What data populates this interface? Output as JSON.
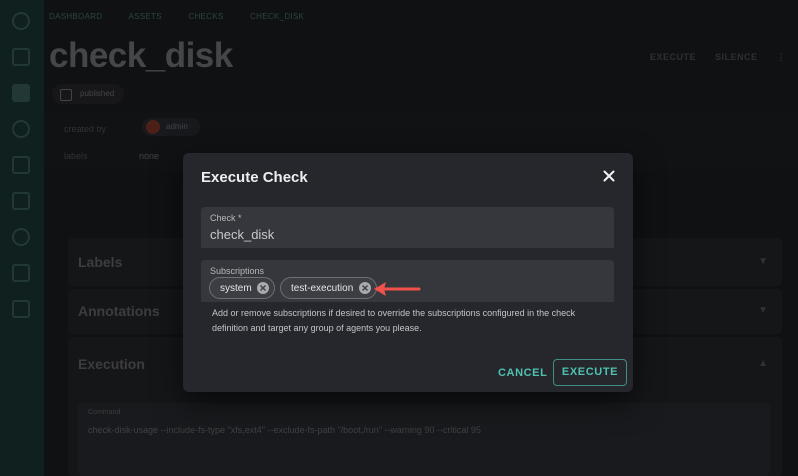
{
  "page": {
    "breadcrumbs": [
      "DASHBOARD",
      "ASSETS",
      "CHECKS",
      "CHECK_DISK"
    ],
    "title": "check_disk",
    "status_chip": "published",
    "actions": [
      "EXECUTE",
      "SILENCE"
    ],
    "meta": {
      "created_by_label": "created by",
      "created_by_value": "admin",
      "labels_label": "labels",
      "labels_value": "none"
    },
    "panels": [
      "Labels",
      "Annotations",
      "Execution"
    ],
    "command": {
      "label": "Command",
      "value": "check-disk-usage --include-fs-type \"xfs,ext4\" --exclude-fs-path \"/boot,/run\" --warning 90 --critical 95"
    }
  },
  "dialog": {
    "title": "Execute Check",
    "close_icon": "close-icon",
    "check_field": {
      "label": "Check *",
      "value": "check_disk"
    },
    "subscriptions_field": {
      "label": "Subscriptions",
      "chips": [
        "system",
        "test-execution"
      ]
    },
    "helper_text": "Add or remove subscriptions if desired to override the subscriptions configured in the check definition and target any group of agents you please.",
    "cancel_label": "CANCEL",
    "execute_label": "EXECUTE"
  },
  "colors": {
    "accent": "#4fc2b0",
    "annotation_arrow": "#f0524a",
    "dialog_bg": "#26272c",
    "sidebar_bg": "#1c3b38"
  }
}
